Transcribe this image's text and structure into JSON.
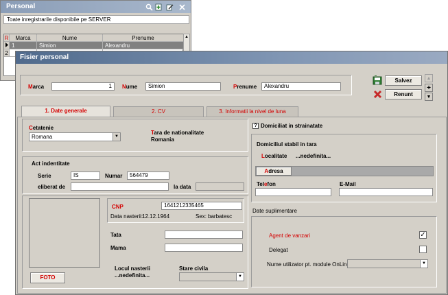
{
  "bg_window": {
    "title": "Personal",
    "caption": "Toate inregistrarile disponibile pe SERVER",
    "columns": [
      "Marca",
      "Nume",
      "Prenume"
    ],
    "rows": [
      {
        "indicator": "1",
        "marca": "1",
        "nume": "Simion",
        "prenume": "Alexandru"
      },
      {
        "indicator": "2",
        "marca": "",
        "nume": "",
        "prenume": ""
      }
    ],
    "row_header_letter": "R"
  },
  "main_window": {
    "title": "Fisier personal",
    "marca_label": "Marca",
    "marca_value": "1",
    "nume_label": "Nume",
    "nume_value": "Simion",
    "prenume_label": "Prenume",
    "prenume_value": "Alexandru",
    "salvez_label": "Salvez",
    "renunt_label": "Renunt",
    "tabs": [
      "1. Date generale",
      "2. CV",
      "3. Informatii la nivel de luna"
    ]
  },
  "general": {
    "cetatenie_label": "Cetatenie",
    "cetatenie_value": "Romana",
    "tara_label": "Tara de nationalitate",
    "tara_value": "Romania",
    "act_label": "Act indentitate",
    "serie_label": "Serie",
    "serie_value": "IS",
    "numar_label": "Numar",
    "numar_value": "564479",
    "eliberat_label": "eliberat de",
    "la_data_label": "la data",
    "cnp_label": "CNP",
    "cnp_value": "1641212335465",
    "data_nasterii_label": "Data nasterii:",
    "data_nasterii_value": "12.12.1964",
    "sex_label": "Sex:",
    "sex_value": "barbatesc",
    "tata_label": "Tata",
    "mama_label": "Mama",
    "locul_nasterii_label": "Locul nasterii",
    "locul_nasterii_value": "...nedefinita...",
    "stare_civila_label": "Stare civila",
    "foto_label": "FOTO"
  },
  "right": {
    "domiciliu_strainatate_label": "Domiciliat in strainatate",
    "domiciliu_strainatate_mark": "?",
    "domiciliu_stabil_label": "Domiciliul stabil in tara",
    "localitate_label": "Localitate",
    "localitate_value": "...nedefinita...",
    "adresa_label": "Adresa",
    "telefon_label": "Telefon",
    "email_label": "E-Mail",
    "date_suplimentare_label": "Date suplimentare",
    "agent_label": "Agent de vanzari",
    "agent_checked": "✓",
    "delegat_label": "Delegat",
    "utilizator_label": "Nume utilizator pt. module OnLine"
  },
  "colors": {
    "window_bg": "#d4d0c8",
    "accent_red": "#d40000",
    "title_blue": "#506a8c"
  }
}
